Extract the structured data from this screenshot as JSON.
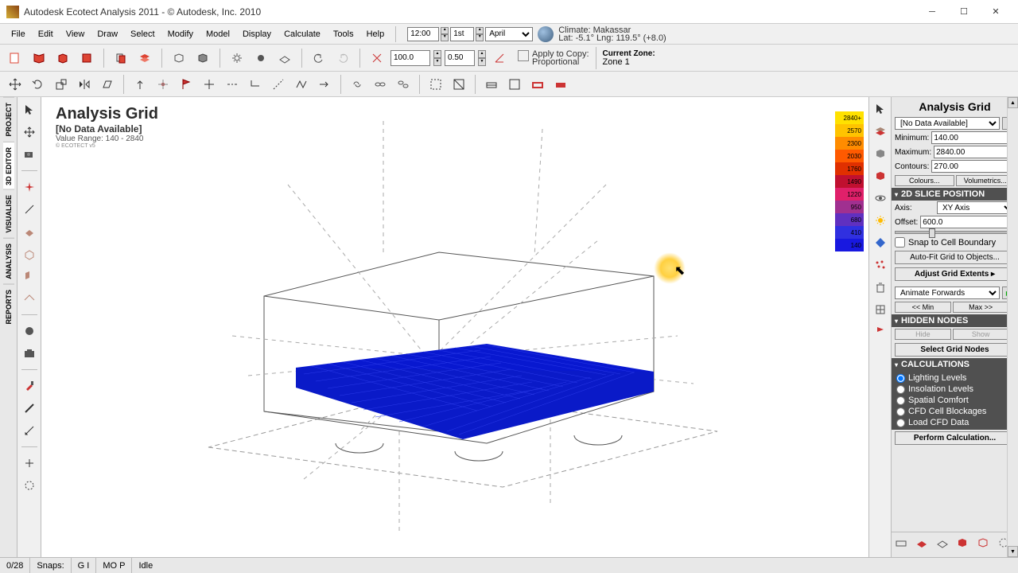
{
  "titlebar": {
    "title": "Autodesk Ecotect Analysis 2011 - © Autodesk, Inc. 2010"
  },
  "menus": [
    "File",
    "Edit",
    "View",
    "Draw",
    "Select",
    "Modify",
    "Model",
    "Display",
    "Calculate",
    "Tools",
    "Help"
  ],
  "timebar": {
    "time": "12:00",
    "day": "1st",
    "month": "April"
  },
  "climate": {
    "line1": "Climate: Makassar",
    "line2": "Lat: -5.1°     Lng: 119.5° (+8.0)"
  },
  "toolbar2": {
    "scale_a": "100.0",
    "scale_b": "0.50",
    "apply_label": "Apply to Copy:",
    "apply_sub": "Proportional",
    "zone_label": "Current Zone:",
    "zone_value": "Zone 1"
  },
  "leftrail": [
    "PROJECT",
    "3D EDITOR",
    "VISUALISE",
    "ANALYSIS",
    "REPORTS"
  ],
  "viewport_overlay": {
    "title": "Analysis Grid",
    "nodata": "[No Data Available]",
    "range": "Value Range: 140 - 2840",
    "copy": "© ECOTECT v5"
  },
  "legend": [
    {
      "v": "2840+",
      "c": "#ffe100"
    },
    {
      "v": "2570",
      "c": "#ffc300"
    },
    {
      "v": "2300",
      "c": "#ff8c00"
    },
    {
      "v": "2030",
      "c": "#ff5a00"
    },
    {
      "v": "1760",
      "c": "#e03000"
    },
    {
      "v": "1490",
      "c": "#c01030"
    },
    {
      "v": "1220",
      "c": "#e0206a"
    },
    {
      "v": "950",
      "c": "#a03090"
    },
    {
      "v": "680",
      "c": "#6030c0"
    },
    {
      "v": "410",
      "c": "#3030e0"
    },
    {
      "v": "140",
      "c": "#1818e0"
    }
  ],
  "rightpanel": {
    "title": "Analysis Grid",
    "data_select": "[No Data Available]",
    "min_label": "Minimum:",
    "min": "140.00",
    "max_label": "Maximum:",
    "max": "2840.00",
    "con_label": "Contours:",
    "con": "270.00",
    "colours": "Colours...",
    "volumetrics": "Volumetrics...",
    "sec_slice": "2D SLICE POSITION",
    "axis_label": "Axis:",
    "axis": "XY Axis",
    "offset_label": "Offset:",
    "offset": "600.0",
    "snap": "Snap to Cell Boundary",
    "autofit": "Auto-Fit Grid to Objects...",
    "extents": "Adjust Grid Extents ▸",
    "anim": "Animate Forwards",
    "min_btn": "<< Min",
    "max_btn": "Max >>",
    "sec_hidden": "HIDDEN NODES",
    "hide": "Hide",
    "show": "Show",
    "select_nodes": "Select Grid Nodes",
    "sec_calc": "CALCULATIONS",
    "calc_opts": [
      "Lighting Levels",
      "Insolation Levels",
      "Spatial Comfort",
      "CFD Cell Blockages",
      "Load CFD Data"
    ],
    "perform": "Perform Calculation..."
  },
  "statusbar": {
    "count": "0/28",
    "snaps": "Snaps:",
    "gi": "G I",
    "mop": "MO P",
    "idle": "Idle"
  }
}
